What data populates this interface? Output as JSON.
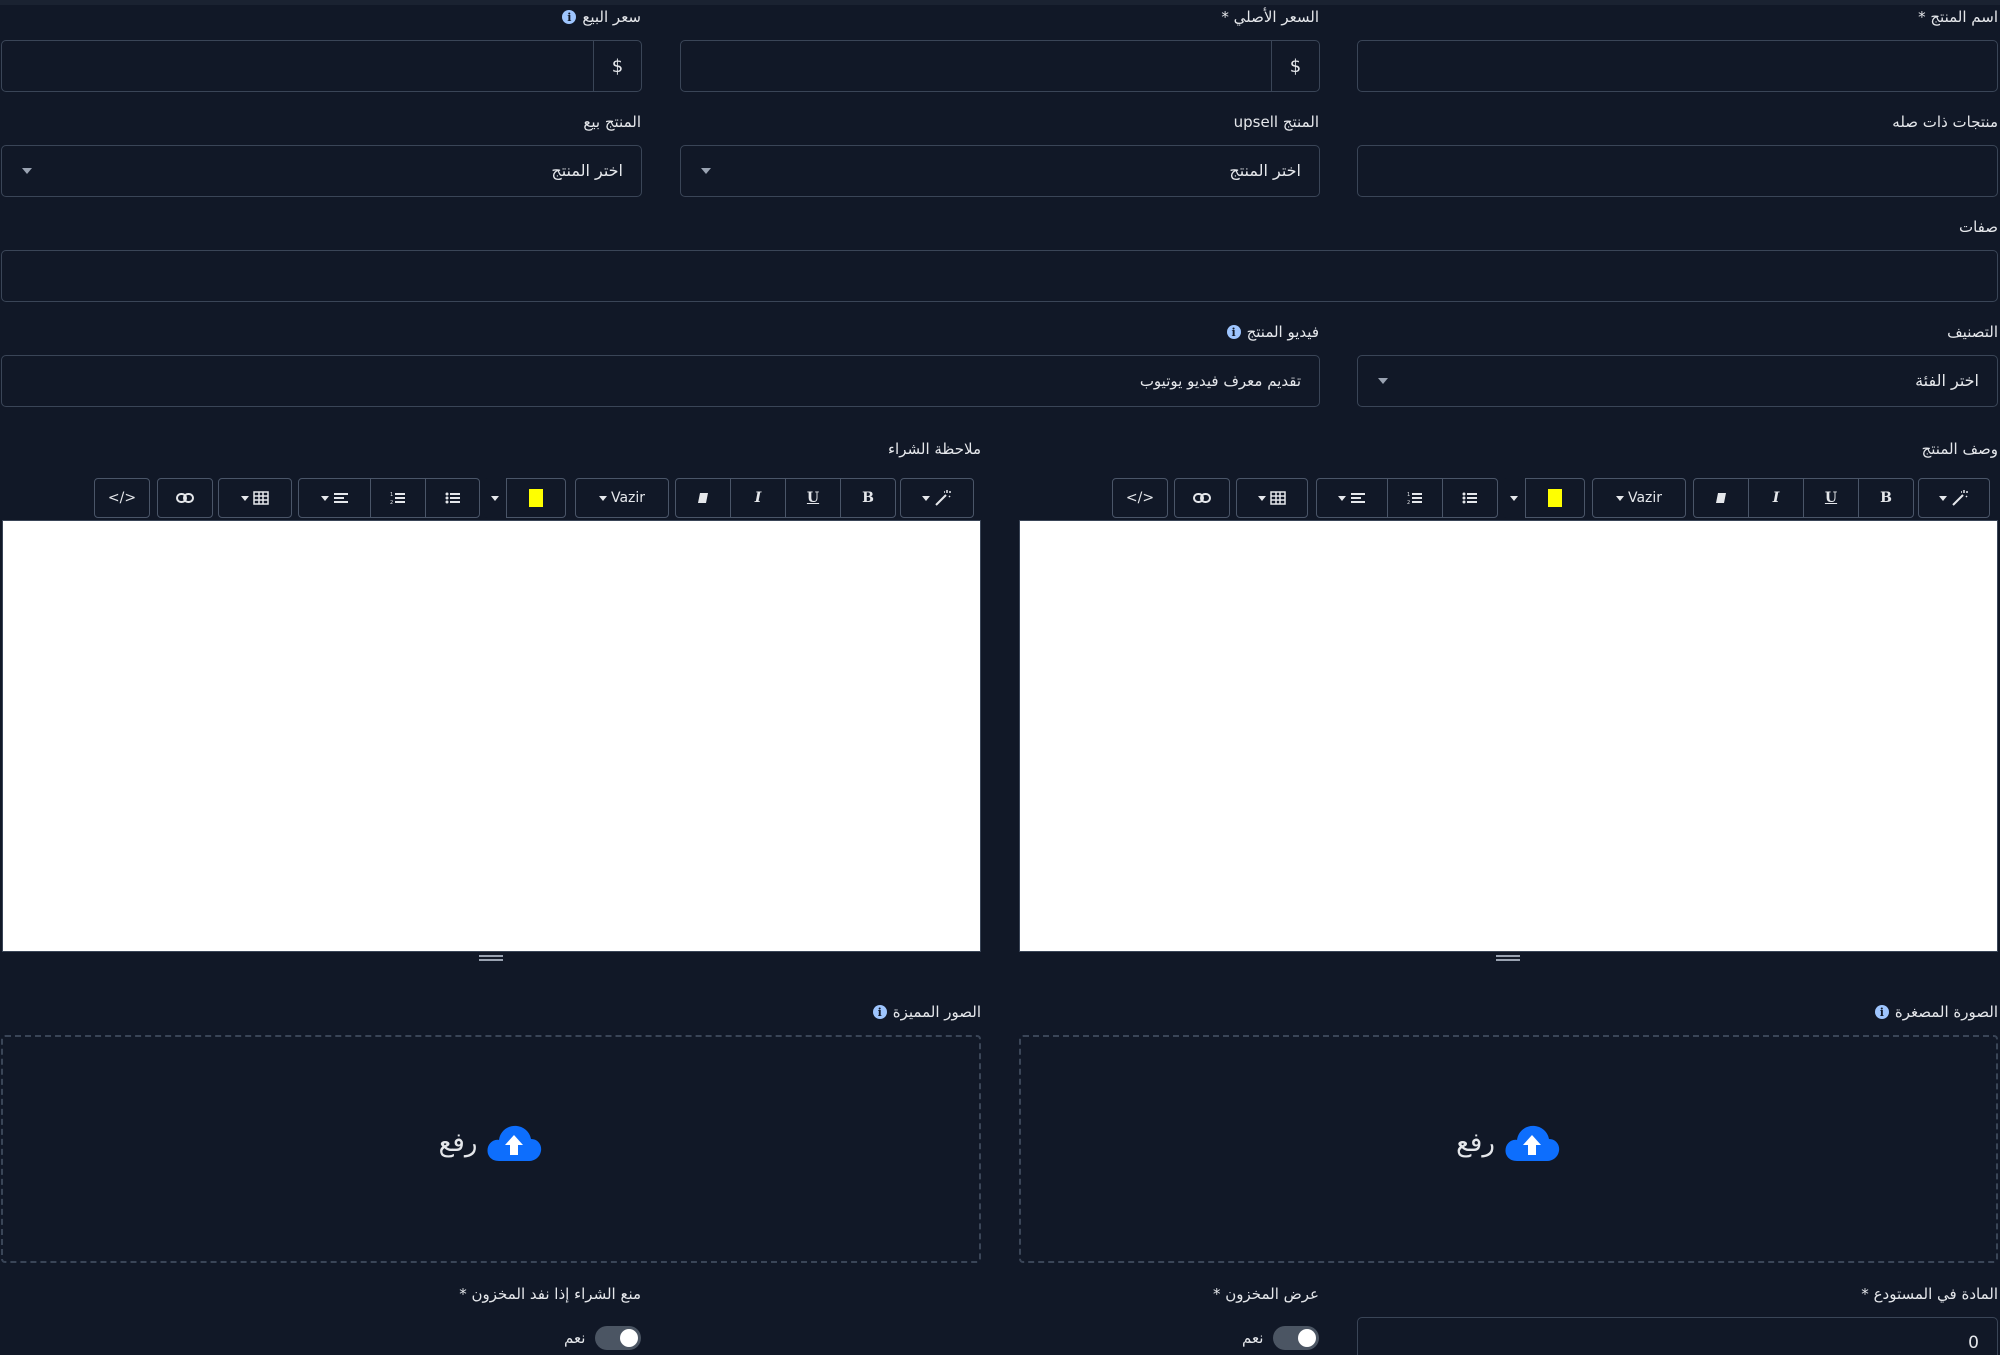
{
  "product_name": {
    "label": "اسم المنتج *",
    "value": ""
  },
  "original_price": {
    "label": "السعر الأصلي *",
    "currency": "$",
    "value": ""
  },
  "sale_price": {
    "label": "سعر البيع",
    "currency": "$",
    "value": ""
  },
  "related_products": {
    "label": "منتجات ذات صله",
    "value": ""
  },
  "upsell_product": {
    "label": "المنتج upsell",
    "placeholder": "اختر المنتج"
  },
  "cross_sell_product": {
    "label": "المنتج بيع",
    "placeholder": "اختر المنتج"
  },
  "attributes": {
    "label": "صفات",
    "value": ""
  },
  "category": {
    "label": "التصنيف",
    "placeholder": "اختر الفئة"
  },
  "product_video": {
    "label": "فيديو المنتج",
    "value": "تقديم معرف فيديو يوتيوب"
  },
  "description_editor": {
    "label": "وصف المنتج",
    "font": "Vazir"
  },
  "purchase_note_editor": {
    "label": "ملاحظة الشراء",
    "font": "Vazir"
  },
  "editor_toolbar": {
    "bold": "B",
    "italic": "I",
    "underline": "U",
    "code": "</>"
  },
  "thumbnail": {
    "label": "الصورة المصغرة",
    "upload_text": "رفع"
  },
  "featured_images": {
    "label": "الصور المميزة",
    "upload_text": "رفع"
  },
  "stock_quantity": {
    "label": "المادة في المستودع *",
    "value": "0"
  },
  "show_stock": {
    "label": "عرض المخزون *",
    "option": "نعم"
  },
  "prevent_purchase": {
    "label": "منع الشراء إذا نفد المخزون *",
    "option": "نعم"
  },
  "colors": {
    "background": "#111827",
    "border": "#3a4557",
    "accent": "#0d6efd",
    "highlight": "#ffff00"
  }
}
